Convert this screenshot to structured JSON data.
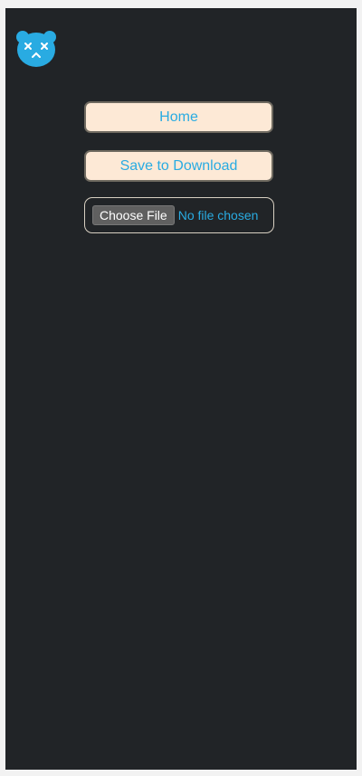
{
  "colors": {
    "accent": "#29abe2",
    "background": "#212427",
    "button_bg": "#fde9d6"
  },
  "logo": {
    "icon": "bear-face-icon"
  },
  "nav": {
    "home_label": "Home",
    "save_label": "Save to Download"
  },
  "file_input": {
    "button_label": "Choose File",
    "status": "No file chosen"
  }
}
